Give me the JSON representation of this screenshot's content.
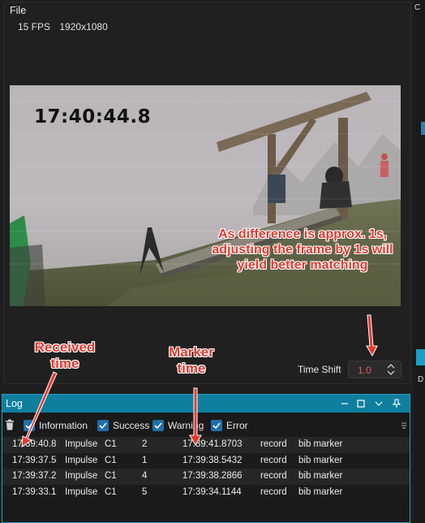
{
  "file_panel": {
    "title": "File",
    "fps": "15 FPS",
    "resolution": "1920x1080",
    "frame_timestamp": "17:40:44.8"
  },
  "time_shift": {
    "label": "Time Shift",
    "value": "1.0"
  },
  "annotations": {
    "note": "As difference is approx. 1s, adjusting the frame by 1s will yield better  matching",
    "received_time": "Received time",
    "marker_time": "Marker time"
  },
  "right_strip": {
    "top_char": "C",
    "mid_char": "D"
  },
  "log": {
    "title": "Log",
    "filters": [
      {
        "label": "Information",
        "checked": true
      },
      {
        "label": "Success",
        "checked": true
      },
      {
        "label": "Warning",
        "checked": true
      },
      {
        "label": "Error",
        "checked": true
      }
    ],
    "rows": [
      {
        "received": "17:39:40.8",
        "type": "Impulse",
        "channel": "C1",
        "number": "2",
        "marker": "17:39:41.8703",
        "source": "record",
        "desc": "bib marker"
      },
      {
        "received": "17:39:37.5",
        "type": "Impulse",
        "channel": "C1",
        "number": "1",
        "marker": "17:39:38.5432",
        "source": "record",
        "desc": "bib marker"
      },
      {
        "received": "17:39:37.2",
        "type": "Impulse",
        "channel": "C1",
        "number": "4",
        "marker": "17:39:38.2866",
        "source": "record",
        "desc": "bib marker"
      },
      {
        "received": "17:39:33.1",
        "type": "Impulse",
        "channel": "C1",
        "number": "5",
        "marker": "17:39:34.1144",
        "source": "record",
        "desc": "bib marker"
      }
    ]
  },
  "colors": {
    "accent": "#0e7f9e",
    "checkbox": "#1f6fa8",
    "annotation": "#e4392e",
    "time_shift_value": "#e05a5a"
  }
}
